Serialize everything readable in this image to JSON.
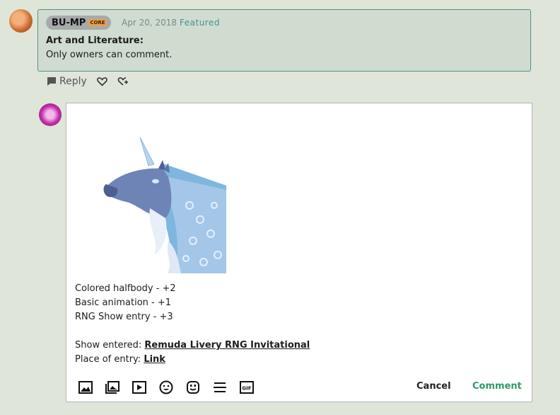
{
  "note": {
    "author": "BU-MP",
    "badge": "CORE",
    "date": "Apr 20, 2018",
    "featured": "Featured",
    "title": "Art and Literature:",
    "body": "Only owners can comment."
  },
  "actions": {
    "reply": "Reply",
    "icons": [
      "comment-icon",
      "heart-icon",
      "share-icon"
    ]
  },
  "editor": {
    "image_alt": "blue unicorn halfbody illustration",
    "lines": [
      "Colored halfbody - +2",
      "Basic animation - +1",
      "RNG Show entry - +3"
    ],
    "show_label": "Show entered:",
    "show_link": "Remuda Livery RNG Invitational",
    "place_label": "Place of entry:",
    "place_link": "Link",
    "toolbar_icons": [
      "image-icon",
      "gallery-icon",
      "video-icon",
      "emoji-icon",
      "emoticon-icon",
      "divider-icon",
      "gif-icon"
    ],
    "cancel": "Cancel",
    "submit": "Comment"
  },
  "colors": {
    "accent": "#2e9a6a",
    "note_border": "#4f8f8d",
    "note_bg": "#d0dcd0",
    "page_bg": "#dfe5d9"
  }
}
